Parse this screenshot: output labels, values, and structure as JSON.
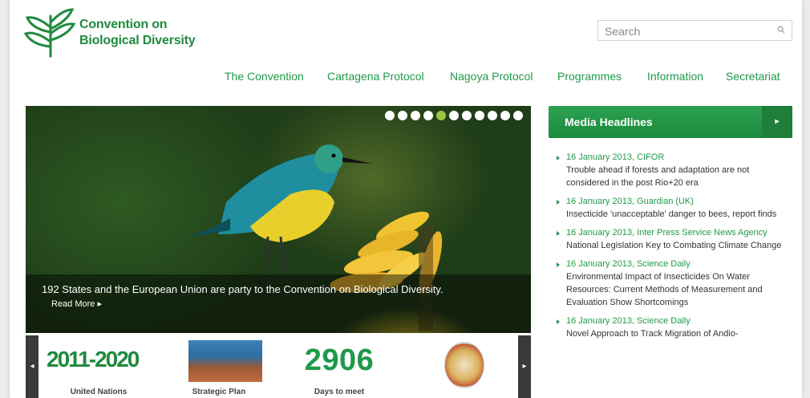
{
  "header": {
    "org_name_line1": "Convention on",
    "org_name_line2": "Biological Diversity",
    "logo_icon": "leaf-logo-icon"
  },
  "search": {
    "placeholder": "Search",
    "icon": "search-icon"
  },
  "nav": {
    "items": [
      {
        "label": "The Convention"
      },
      {
        "label": "Cartagena Protocol"
      },
      {
        "label": "Nagoya Protocol"
      },
      {
        "label": "Programmes"
      },
      {
        "label": "Information"
      },
      {
        "label": "Secretariat"
      }
    ]
  },
  "hero": {
    "slide_count": 11,
    "active_slide": 4,
    "caption": "192 States and the European Union are party to the Convention on Biological Diversity.",
    "read_more": "Read More ▸"
  },
  "tiles": {
    "prev_icon": "chevron-left-icon",
    "next_icon": "chevron-right-icon",
    "items": [
      {
        "title": "2011-2020",
        "caption": "United Nations"
      },
      {
        "caption": "Strategic Plan"
      },
      {
        "number": "2906",
        "caption": "Days to meet"
      },
      {
        "caption": ""
      }
    ]
  },
  "media": {
    "title": "Media Headlines",
    "items": [
      {
        "date": "16 January 2013, CIFOR",
        "title": "Trouble ahead if forests and adaptation are not considered in the post Rio+20 era"
      },
      {
        "date": "16 January 2013, Guardian (UK)",
        "title": "Insecticide 'unacceptable' danger to bees, report finds"
      },
      {
        "date": "16 January 2013, Inter Press Service News Agency",
        "title": "National Legislation Key to Combating Climate Change"
      },
      {
        "date": "16 January 2013, Science Daily",
        "title": "Environmental Impact of Insecticides On Water Resources: Current Methods of Measurement and Evaluation Show Shortcomings"
      },
      {
        "date": "16 January 2013, Science Daily",
        "title": "Novel Approach to Track Migration of Andio-"
      }
    ]
  },
  "colors": {
    "brand_green": "#1f8a3e",
    "link_green": "#1f9a4a",
    "dot_active": "#9dc342"
  }
}
